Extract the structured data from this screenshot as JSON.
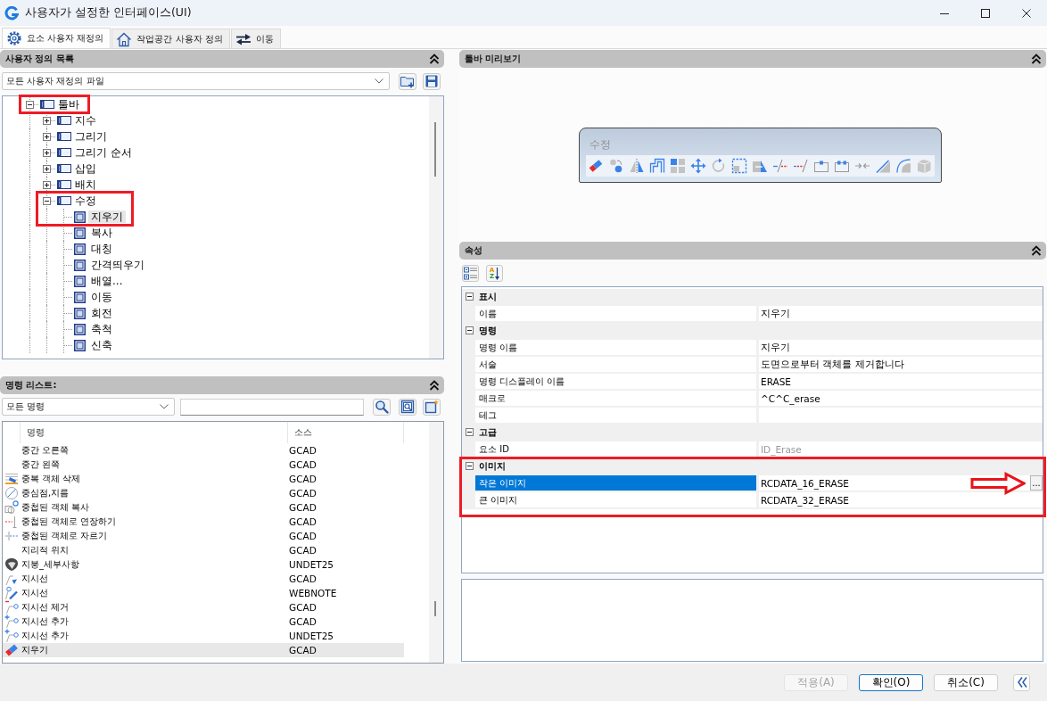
{
  "window": {
    "title": "사용자가 설정한 인터페이스(UI)"
  },
  "tabs": [
    {
      "label": "요소 사용자 재정의",
      "selected": true
    },
    {
      "label": "작업공간 사용자 정의",
      "selected": false
    },
    {
      "label": "이동",
      "selected": false
    }
  ],
  "customizations": {
    "title": "사용자 정의 목록",
    "file_filter": "모든 사용자 재정의 파일",
    "tree": [
      {
        "label": "툴바",
        "expanded": true,
        "selected": false,
        "highlighted": true,
        "children": [
          {
            "label": "지수",
            "expanded": false,
            "selected": false,
            "highlighted": false
          },
          {
            "label": "그리기",
            "expanded": false,
            "selected": false,
            "highlighted": false
          },
          {
            "label": "그리기 순서",
            "expanded": false,
            "selected": false,
            "highlighted": false
          },
          {
            "label": "삽입",
            "expanded": false,
            "selected": false,
            "highlighted": false
          },
          {
            "label": "배치",
            "expanded": false,
            "selected": false,
            "highlighted": false
          },
          {
            "label": "수정",
            "expanded": true,
            "selected": false,
            "highlighted": true,
            "children": [
              {
                "label": "지우기",
                "selected": true,
                "highlighted": true
              },
              {
                "label": "복사",
                "selected": false,
                "highlighted": false
              },
              {
                "label": "대칭",
                "selected": false,
                "highlighted": false
              },
              {
                "label": "간격띄우기",
                "selected": false,
                "highlighted": false
              },
              {
                "label": "배열...",
                "selected": false,
                "highlighted": false
              },
              {
                "label": "이동",
                "selected": false,
                "highlighted": false
              },
              {
                "label": "회전",
                "selected": false,
                "highlighted": false
              },
              {
                "label": "축척",
                "selected": false,
                "highlighted": false
              },
              {
                "label": "신축",
                "selected": false,
                "highlighted": false
              }
            ]
          }
        ]
      }
    ]
  },
  "commands": {
    "title": "명령 리스트:",
    "filter": "모든 명령",
    "columns": [
      "명령",
      "소스"
    ],
    "rows": [
      {
        "name": "중간 오른쪽",
        "source": "GCAD",
        "selected": false
      },
      {
        "name": "중간 왼쪽",
        "source": "GCAD",
        "selected": false
      },
      {
        "name": "중복 객체 삭제",
        "source": "GCAD",
        "selected": false
      },
      {
        "name": "중심점,지름",
        "source": "GCAD",
        "selected": false
      },
      {
        "name": "중첩된 객체 복사",
        "source": "GCAD",
        "selected": false
      },
      {
        "name": "중첩된 객체로 연장하기",
        "source": "GCAD",
        "selected": false
      },
      {
        "name": "중첩된 객체로 자르기",
        "source": "GCAD",
        "selected": false
      },
      {
        "name": "지리적 위치",
        "source": "GCAD",
        "selected": false
      },
      {
        "name": "지붕_세부사항",
        "source": "UNDET25",
        "selected": false
      },
      {
        "name": "지시선",
        "source": "GCAD",
        "selected": false
      },
      {
        "name": "지시선",
        "source": "WEBNOTE",
        "selected": false
      },
      {
        "name": "지시선 제거",
        "source": "GCAD",
        "selected": false
      },
      {
        "name": "지시선 추가",
        "source": "GCAD",
        "selected": false
      },
      {
        "name": "지시선 추가",
        "source": "UNDET25",
        "selected": false
      },
      {
        "name": "지우기",
        "source": "GCAD",
        "selected": true
      }
    ]
  },
  "preview": {
    "title": "툴바 미리보기",
    "toolbar_title": "수정"
  },
  "properties": {
    "title": "속성",
    "sort_letters": [
      "A",
      "Z"
    ],
    "categories": [
      {
        "label": "표시",
        "expanded": true,
        "highlighted": false,
        "rows": [
          {
            "label": "이름",
            "value": "지우기",
            "selected": false,
            "readonly": false,
            "arrow": false
          }
        ]
      },
      {
        "label": "명령",
        "expanded": true,
        "highlighted": false,
        "rows": [
          {
            "label": "명령 이름",
            "value": "지우기",
            "selected": false,
            "readonly": false,
            "arrow": false
          },
          {
            "label": "서술",
            "value": "도면으로부터 객체를 제거합니다",
            "selected": false,
            "readonly": false,
            "arrow": false
          },
          {
            "label": "명령 디스플레이 이름",
            "value": "ERASE",
            "selected": false,
            "readonly": false,
            "arrow": false
          },
          {
            "label": "매크로",
            "value": "^C^C_erase",
            "selected": false,
            "readonly": false,
            "arrow": false
          },
          {
            "label": "테그",
            "selected": false,
            "arrow": false
          }
        ]
      },
      {
        "label": "고급",
        "expanded": true,
        "highlighted": false,
        "rows": [
          {
            "label": "요소 ID",
            "value": "ID_Erase",
            "selected": false,
            "readonly": true,
            "arrow": false
          }
        ]
      },
      {
        "label": "이미지",
        "expanded": true,
        "highlighted": true,
        "rows": [
          {
            "label": "작은 이미지",
            "value": "RCDATA_16_ERASE",
            "selected": true,
            "readonly": false,
            "arrow": true,
            "button": "..."
          },
          {
            "label": "큰 이미지",
            "value": "RCDATA_32_ERASE",
            "selected": false,
            "readonly": false,
            "arrow": false
          }
        ]
      }
    ]
  },
  "footer": {
    "buttons": [
      {
        "label": "적용(A)",
        "disabled": true,
        "default": false
      },
      {
        "label": "확인(O)",
        "disabled": false,
        "default": true
      },
      {
        "label": "취소(C)",
        "disabled": false,
        "default": false
      }
    ]
  }
}
